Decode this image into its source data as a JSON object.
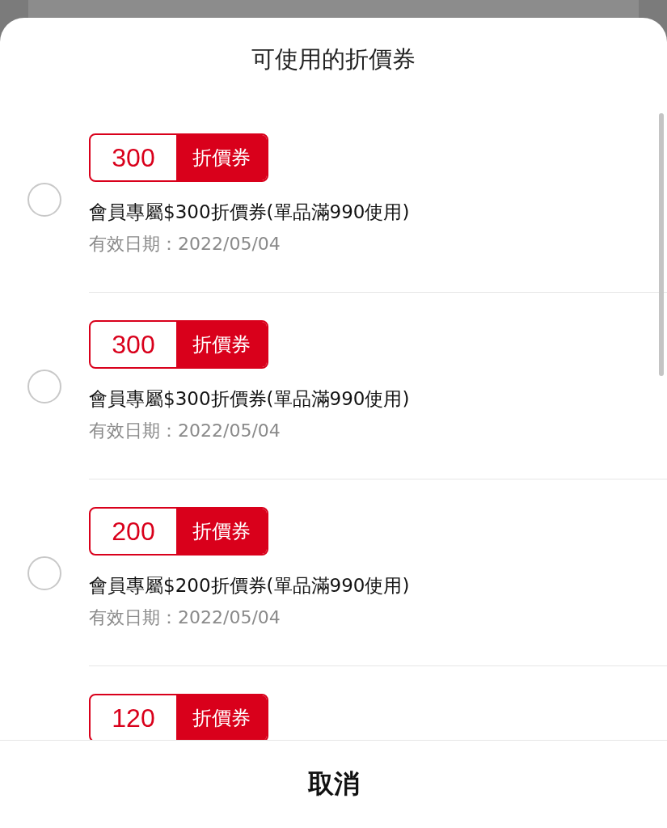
{
  "sheet": {
    "title": "可使用的折價券"
  },
  "coupons": [
    {
      "amount": "300",
      "badge_label": "折價券",
      "name": "會員專屬$300折價券(單品滿990使用)",
      "expiry": "有效日期：2022/05/04",
      "selected": false
    },
    {
      "amount": "300",
      "badge_label": "折價券",
      "name": "會員專屬$300折價券(單品滿990使用)",
      "expiry": "有效日期：2022/05/04",
      "selected": false
    },
    {
      "amount": "200",
      "badge_label": "折價券",
      "name": "會員專屬$200折價券(單品滿990使用)",
      "expiry": "有效日期：2022/05/04",
      "selected": false
    },
    {
      "amount": "120",
      "badge_label": "折價券"
    }
  ],
  "cancel_button": "取消"
}
